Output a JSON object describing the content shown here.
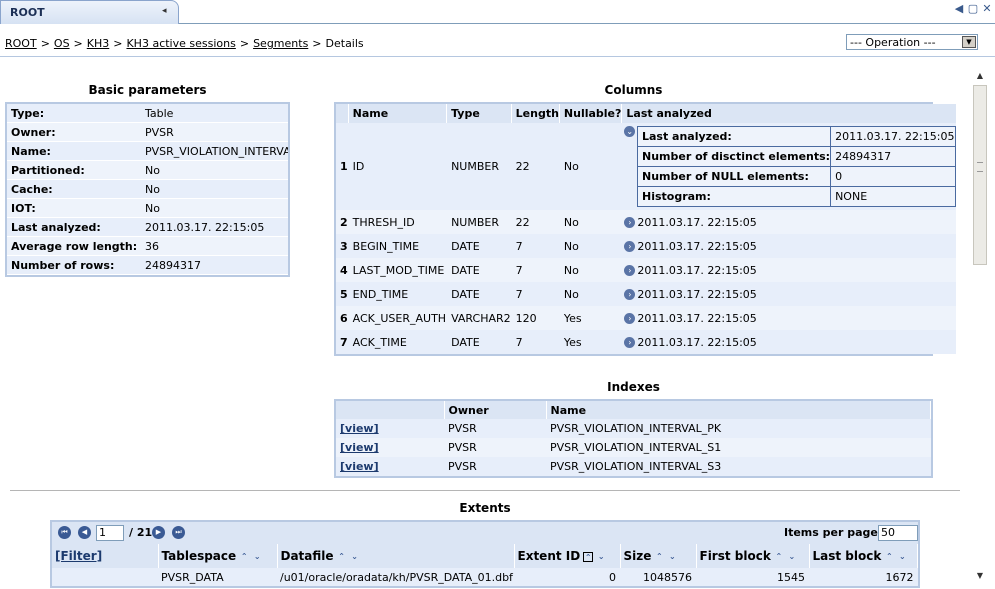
{
  "tab": {
    "title": "ROOT",
    "collapse_icon": "◂"
  },
  "window_controls": [
    "◀",
    "▢",
    "✕"
  ],
  "breadcrumb": {
    "items": [
      "ROOT",
      "OS",
      "KH3",
      "KH3 active sessions",
      "Segments"
    ],
    "current": "Details",
    "separator": ">"
  },
  "operation": {
    "label": "--- Operation ---"
  },
  "basic_parameters": {
    "title": "Basic parameters",
    "rows": [
      {
        "key": "Type:",
        "value": "Table"
      },
      {
        "key": "Owner:",
        "value": "PVSR"
      },
      {
        "key": "Name:",
        "value": "PVSR_VIOLATION_INTERVAL"
      },
      {
        "key": "Partitioned:",
        "value": "No"
      },
      {
        "key": "Cache:",
        "value": "No"
      },
      {
        "key": "IOT:",
        "value": "No"
      },
      {
        "key": "Last analyzed:",
        "value": "2011.03.17. 22:15:05"
      },
      {
        "key": "Average row length:",
        "value": "36"
      },
      {
        "key": "Number of rows:",
        "value": "24894317"
      }
    ]
  },
  "columns": {
    "title": "Columns",
    "headers": [
      "",
      "Name",
      "Type",
      "Length",
      "Nullable?",
      "Last analyzed"
    ],
    "first_row": {
      "num": "1",
      "name": "ID",
      "type": "NUMBER",
      "length": "22",
      "nullable": "No"
    },
    "first_row_details": [
      {
        "key": "Last analyzed:",
        "value": "2011.03.17. 22:15:05"
      },
      {
        "key": "Number of disctinct elements:",
        "value": "24894317"
      },
      {
        "key": "Number of NULL elements:",
        "value": "0"
      },
      {
        "key": "Histogram:",
        "value": "NONE"
      }
    ],
    "rows": [
      {
        "num": "2",
        "name": "THRESH_ID",
        "type": "NUMBER",
        "length": "22",
        "nullable": "No",
        "last_analyzed": "2011.03.17. 22:15:05"
      },
      {
        "num": "3",
        "name": "BEGIN_TIME",
        "type": "DATE",
        "length": "7",
        "nullable": "No",
        "last_analyzed": "2011.03.17. 22:15:05"
      },
      {
        "num": "4",
        "name": "LAST_MOD_TIME",
        "type": "DATE",
        "length": "7",
        "nullable": "No",
        "last_analyzed": "2011.03.17. 22:15:05"
      },
      {
        "num": "5",
        "name": "END_TIME",
        "type": "DATE",
        "length": "7",
        "nullable": "No",
        "last_analyzed": "2011.03.17. 22:15:05"
      },
      {
        "num": "6",
        "name": "ACK_USER_AUTH",
        "type": "VARCHAR2",
        "length": "120",
        "nullable": "Yes",
        "last_analyzed": "2011.03.17. 22:15:05"
      },
      {
        "num": "7",
        "name": "ACK_TIME",
        "type": "DATE",
        "length": "7",
        "nullable": "Yes",
        "last_analyzed": "2011.03.17. 22:15:05"
      }
    ]
  },
  "indexes": {
    "title": "Indexes",
    "headers": [
      "",
      "Owner",
      "Name"
    ],
    "rows": [
      {
        "link": "[view]",
        "owner": "PVSR",
        "name": "PVSR_VIOLATION_INTERVAL_PK"
      },
      {
        "link": "[view]",
        "owner": "PVSR",
        "name": "PVSR_VIOLATION_INTERVAL_S1"
      },
      {
        "link": "[view]",
        "owner": "PVSR",
        "name": "PVSR_VIOLATION_INTERVAL_S3"
      }
    ]
  },
  "extents": {
    "title": "Extents",
    "pager": {
      "page": "1",
      "total": "/ 21",
      "items_per_page_label": "Items per page:",
      "items_per_page": "50"
    },
    "filter_label": "[Filter]",
    "headers": [
      "Tablespace",
      "Datafile",
      "Extent ID",
      "Size",
      "First block",
      "Last block"
    ],
    "rows": [
      {
        "filter": "",
        "tablespace": "PVSR_DATA",
        "datafile": "/u01/oracle/oradata/kh/PVSR_DATA_01.dbf",
        "extent_id": "0",
        "size": "1048576",
        "first_block": "1545",
        "last_block": "1672"
      }
    ]
  }
}
